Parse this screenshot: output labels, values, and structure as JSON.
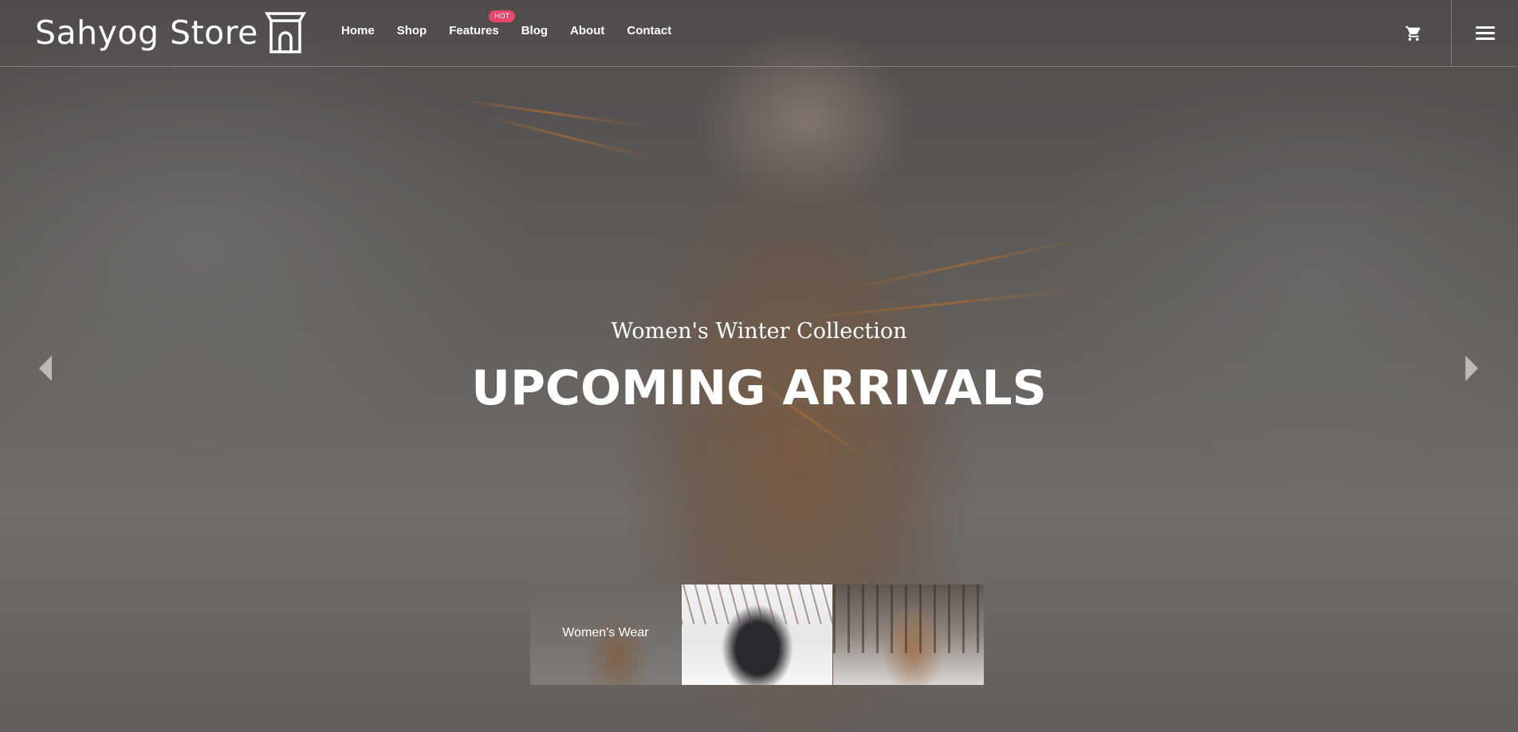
{
  "header": {
    "logo_text": "Sahyog Store",
    "logo_icon": "storefront-icon",
    "nav": [
      {
        "label": "Home"
      },
      {
        "label": "Shop"
      },
      {
        "label": "Features",
        "badge": "HOT"
      },
      {
        "label": "Blog"
      },
      {
        "label": "About"
      },
      {
        "label": "Contact"
      }
    ],
    "cart_icon": "cart-icon",
    "menu_icon": "hamburger-menu-icon"
  },
  "hero": {
    "subtitle": "Women's Winter Collection",
    "title": "UPCOMING ARRIVALS",
    "prev_icon": "chevron-left-icon",
    "next_icon": "chevron-right-icon"
  },
  "thumbnails": [
    {
      "label": "Women's Wear"
    },
    {
      "label": ""
    },
    {
      "label": ""
    }
  ],
  "colors": {
    "badge": "#e8466b",
    "text": "#ffffff"
  }
}
